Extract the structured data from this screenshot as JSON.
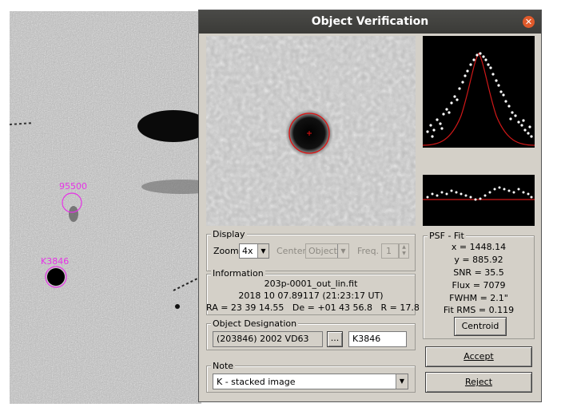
{
  "background": {
    "labels": [
      {
        "text": "95500",
        "color": "#e633e6"
      },
      {
        "text": "K3846",
        "color": "#e633e6"
      }
    ]
  },
  "dialog": {
    "title": "Object Verification",
    "close_icon": "close-icon",
    "display": {
      "legend": "Display",
      "zoom_label": "Zoom",
      "zoom_value": "4x",
      "center_label": "Center",
      "center_value": "Object",
      "freq_label": "Freq.",
      "freq_value": "1"
    },
    "information": {
      "legend": "Information",
      "filename": "203p-0001_out_lin.fit",
      "datetime": "2018 10 07.89117 (21:23:17 UT)",
      "coords": "RA = 23 39 14.55   De = +01 43 56.8   R = 17.8"
    },
    "designation": {
      "legend": "Object Designation",
      "value": "(203846) 2002 VD63",
      "browse_label": "...",
      "code": "K3846"
    },
    "note": {
      "legend": "Note",
      "value": "K - stacked image"
    },
    "psf": {
      "legend": "PSF - Fit",
      "x": "x = 1448.14",
      "y": "y = 885.92",
      "snr": "SNR = 35.5",
      "flux": "Flux = 7079",
      "fwhm": "FWHM = 2.1\"",
      "rms": "Fit RMS = 0.119",
      "centroid_label": "Centroid"
    },
    "buttons": {
      "accept": "Accept",
      "reject": "Reject"
    }
  }
}
